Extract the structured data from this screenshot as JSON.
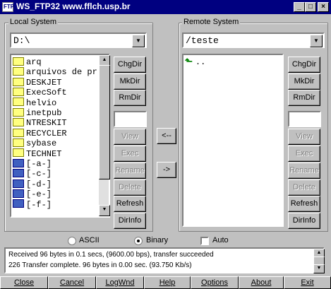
{
  "window": {
    "title": "WS_FTP32 www.fflch.usp.br",
    "icon_text": "FTP",
    "minimize": "_",
    "maximize": "□",
    "close": "×"
  },
  "local": {
    "group_label": "Local System",
    "path": "D:\\",
    "items": [
      {
        "icon": "folder-icon",
        "name": "arq"
      },
      {
        "icon": "folder-icon",
        "name": "arquivos de pr"
      },
      {
        "icon": "folder-icon",
        "name": "DESKJET"
      },
      {
        "icon": "folder-icon",
        "name": "ExecSoft"
      },
      {
        "icon": "folder-icon",
        "name": "helvio"
      },
      {
        "icon": "folder-icon",
        "name": "inetpub"
      },
      {
        "icon": "folder-icon",
        "name": "NTRESKIT"
      },
      {
        "icon": "folder-icon",
        "name": "RECYCLER"
      },
      {
        "icon": "folder-icon",
        "name": "sybase"
      },
      {
        "icon": "folder-icon",
        "name": "TECHNET"
      },
      {
        "icon": "drive-icon",
        "name": "[-a-]"
      },
      {
        "icon": "drive-icon",
        "name": "[-c-]"
      },
      {
        "icon": "drive-icon",
        "name": "[-d-]"
      },
      {
        "icon": "drive-icon",
        "name": "[-e-]"
      },
      {
        "icon": "drive-icon",
        "name": "[-f-]"
      }
    ],
    "buttons": {
      "chgdir": "ChgDir",
      "mkdir": "MkDir",
      "rmdir": "RmDir",
      "view": "View",
      "exec": "Exec",
      "rename": "Rename",
      "delete": "Delete",
      "refresh": "Refresh",
      "dirinfo": "DirInfo"
    }
  },
  "transfer": {
    "to_local": "<--",
    "to_remote": "->"
  },
  "remote": {
    "group_label": "Remote System",
    "path": "/teste",
    "items": [
      {
        "icon": "parent-dir-icon",
        "name": ".."
      }
    ],
    "buttons": {
      "chgdir": "ChgDir",
      "mkdir": "MkDir",
      "rmdir": "RmDir",
      "view": "View",
      "exec": "Exec",
      "rename": "Rename",
      "delete": "Delete",
      "refresh": "Refresh",
      "dirinfo": "DirInfo"
    }
  },
  "mode": {
    "ascii": "ASCII",
    "binary": "Binary",
    "auto": "Auto",
    "selected": "Binary"
  },
  "log": {
    "lines": [
      "Received 96 bytes in 0.1 secs, (9600.00 bps), transfer succeeded",
      "226 Transfer complete. 96 bytes in 0.00 sec. (93.750 Kb/s)"
    ]
  },
  "bottom_buttons": {
    "close": "Close",
    "cancel": "Cancel",
    "logwnd": "LogWnd",
    "help": "Help",
    "options": "Options",
    "about": "About",
    "exit": "Exit"
  }
}
